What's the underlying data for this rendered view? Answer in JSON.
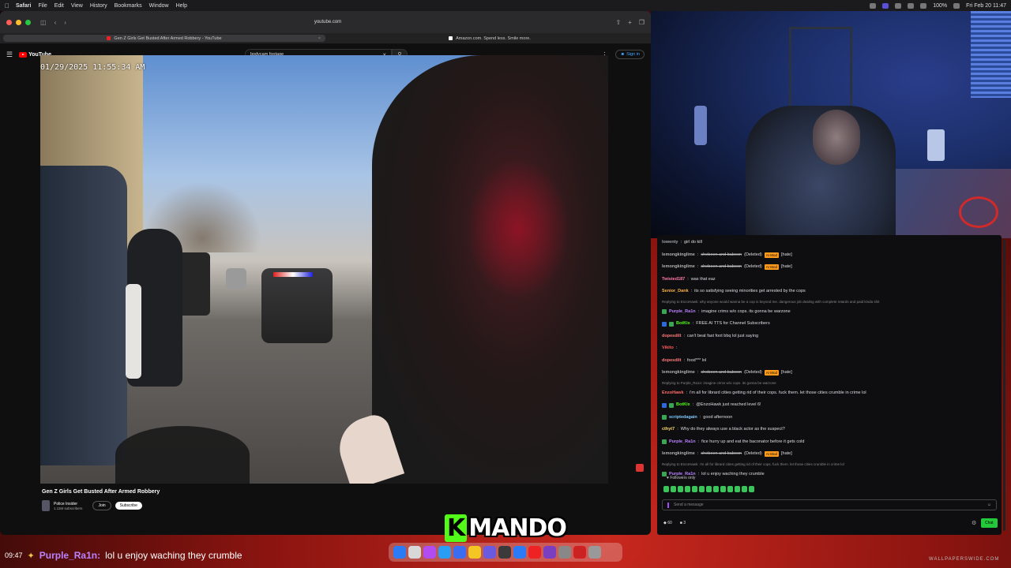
{
  "menubar": {
    "app": "Safari",
    "items": [
      "File",
      "Edit",
      "View",
      "History",
      "Bookmarks",
      "Window",
      "Help"
    ],
    "battery": "100%",
    "datetime": "Fri Feb 20 11:47"
  },
  "browser": {
    "url": "youtube.com",
    "tabs": [
      {
        "title": "Gen Z Girls Get Busted After Armed Robbery - YouTube",
        "active": true
      },
      {
        "title": "Amazon.com. Spend less. Smile more.",
        "active": false
      }
    ]
  },
  "youtube": {
    "logo": "YouTube",
    "search_value": "bodycam footage",
    "sign_in": "Sign in",
    "video": {
      "timestamp": "01/29/2025 11:55:34 AM",
      "title": "Gen Z Girls Get Busted After Armed Robbery",
      "channel": "Police Insider",
      "subscribers": "1.11M subscribers",
      "join": "Join",
      "subscribe": "Subscribe"
    }
  },
  "chat": {
    "messages": [
      {
        "user": "lowenty",
        "user_color": "#9aa0a6",
        "text": "girl do kill"
      },
      {
        "user": "lemongkinglime",
        "user_color": "#b0b0b0",
        "deleted": "shebeen and baboon",
        "tag": "(Deleted)",
        "badge": "AI Mod",
        "extra": "[hate]"
      },
      {
        "user": "lemongkinglime",
        "user_color": "#b0b0b0",
        "deleted": "shebeen and baboon",
        "tag": "(Deleted)",
        "badge": "AI Mod",
        "extra": "[hate]"
      },
      {
        "user": "Twisted187",
        "user_color": "#ff7aa8",
        "text": "was that eaz"
      },
      {
        "user": "Senior_Dank",
        "user_color": "#ffb347",
        "text": "its so satisfying seeing minorities get arrested by the cops"
      },
      {
        "reply": "Replying to EnzoHawk: why anyone would wanna be a cop is beyond me. dangerous job dealing with complete retards and paid kinda shit"
      },
      {
        "user": "Purple_Ra1n",
        "user_color": "#b982ff",
        "text": "imagine crims w/o cops. its gonna be warzone"
      },
      {
        "user": "BotKix",
        "user_color": "#53fc18",
        "text": "FREE AI TTS for Channel Subscribers"
      },
      {
        "user": "dopesdilt",
        "user_color": "#ff7a7a",
        "text": "can't beat fast foot bbq lol just saying"
      },
      {
        "user": "Vikito",
        "user_color": "#ff5c5c",
        "text": ""
      },
      {
        "user": "dopesdilt",
        "user_color": "#ff7a7a",
        "text": "food*** lol"
      },
      {
        "user": "lemongkinglime",
        "user_color": "#b0b0b0",
        "deleted": "shebeen and baboon",
        "tag": "(Deleted)",
        "badge": "AI Mod",
        "extra": "[hate]"
      },
      {
        "reply": "Replying to Purple_Ra1n: imagine crims w/o cops. its gonna be warzone"
      },
      {
        "user": "EnzoHawk",
        "user_color": "#ff6b6b",
        "text": "i'm all for librard cities getting rid of their cops. fuck them. let those cities crumble in crime lol"
      },
      {
        "user": "BotKix",
        "user_color": "#53fc18",
        "text": "@EnzoHawk just reached level 6!"
      },
      {
        "user": "scriptedagain",
        "user_color": "#7ec8ff",
        "text": "good afternoon"
      },
      {
        "user": "cthyt7",
        "user_color": "#ffd966",
        "text": "Why do they always use a black actor as the suspect?"
      },
      {
        "user": "Purple_Ra1n",
        "user_color": "#b982ff",
        "text": "fice hurry up and eat the baconator before it gets cold"
      },
      {
        "user": "lemongkinglime",
        "user_color": "#b0b0b0",
        "deleted": "shebeen and baboon",
        "tag": "(Deleted)",
        "badge": "AI Mod",
        "extra": "[hate]"
      },
      {
        "reply": "Replying to EnzoHawk: i'm all for librard cities getting rid of their cops. fuck them. let those cities crumble in crime lol"
      },
      {
        "user": "Purple_Ra1n",
        "user_color": "#b982ff",
        "text": "lol u enjoy waching they crumble"
      }
    ],
    "followers_only": "Followers only",
    "input_placeholder": "Send a message",
    "viewers": "60",
    "count": "3",
    "chat_button": "Chat"
  },
  "overlay": {
    "time": "09:47",
    "user": "Purple_Ra1n:",
    "message": "lol u enjoy waching they crumble",
    "brand_k": "K",
    "brand_rest": "MANDO",
    "watermark": "WALLPAPERSWIDE.COM"
  },
  "dock_colors": [
    "#2a7bf5",
    "#d8d8d8",
    "#b04cf0",
    "#2a9df4",
    "#3c6cf0",
    "#f3c623",
    "#6a5ae0",
    "#3a3a3a",
    "#2a7bf5",
    "#e22",
    "#7a3fc0",
    "#888",
    "#c22",
    "#999"
  ]
}
